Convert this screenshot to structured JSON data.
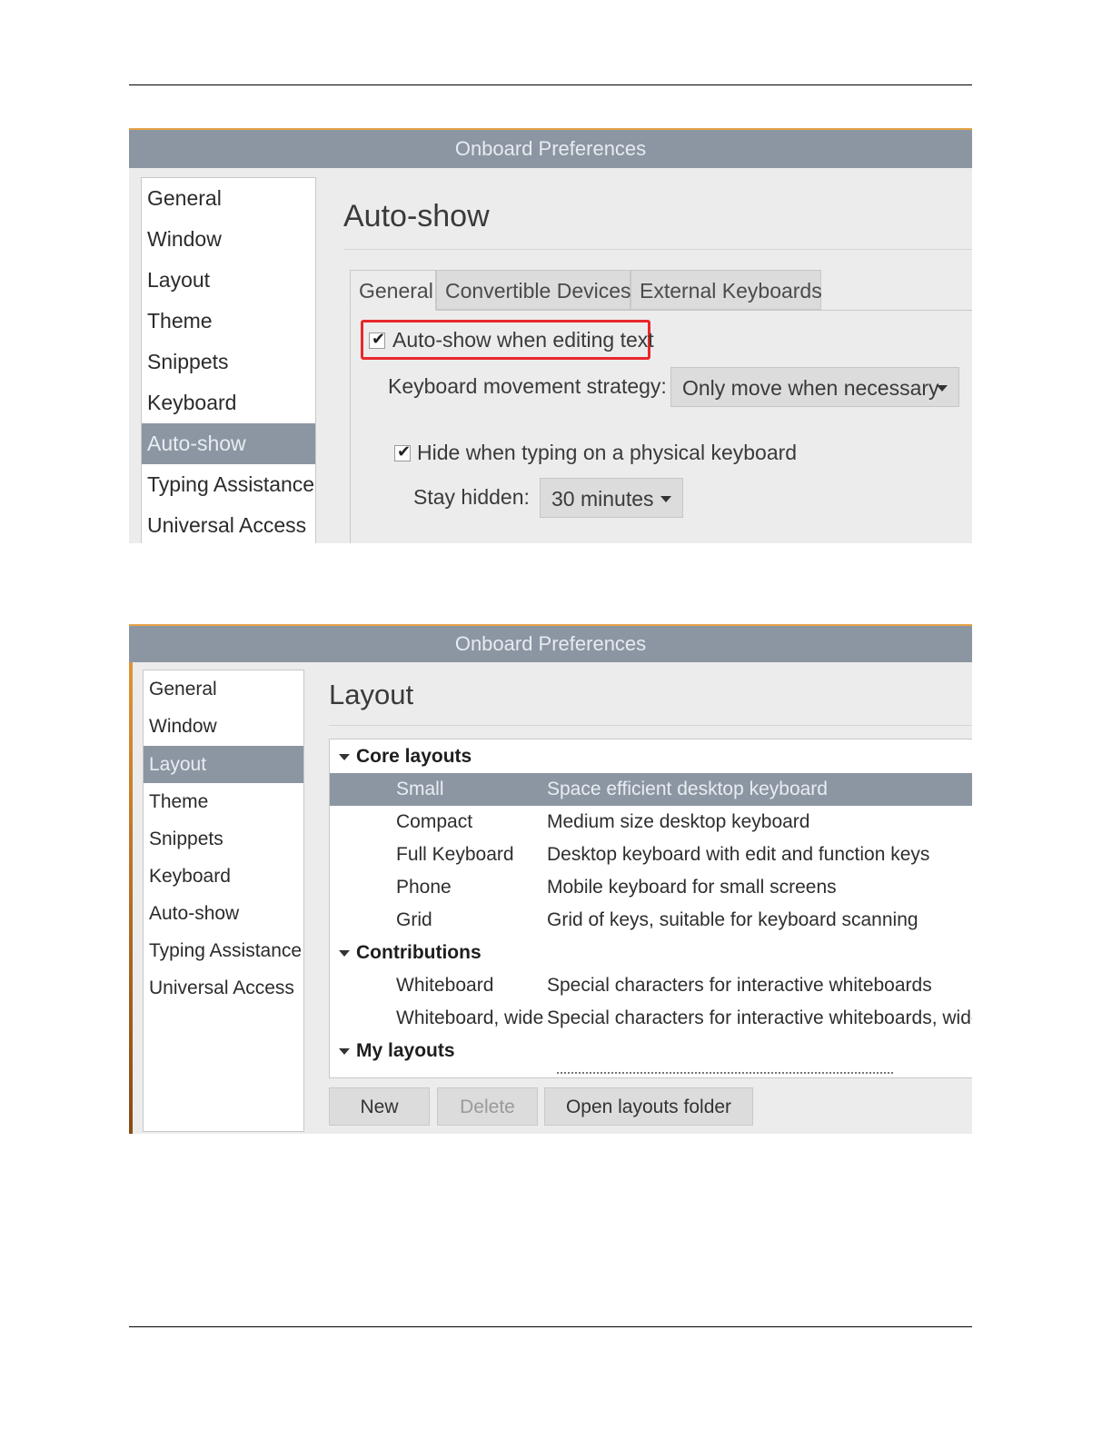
{
  "screenshot1": {
    "window_title": "Onboard Preferences",
    "sidebar": [
      {
        "label": "General"
      },
      {
        "label": "Window"
      },
      {
        "label": "Layout"
      },
      {
        "label": "Theme"
      },
      {
        "label": "Snippets"
      },
      {
        "label": "Keyboard"
      },
      {
        "label": "Auto-show",
        "active": true
      },
      {
        "label": "Typing Assistance"
      },
      {
        "label": "Universal Access"
      }
    ],
    "page_title": "Auto-show",
    "tabs": [
      {
        "label": "General",
        "active": true
      },
      {
        "label": "Convertible Devices"
      },
      {
        "label": "External Keyboards"
      }
    ],
    "auto_show_label": "Auto-show when editing text",
    "auto_show_checked": true,
    "movement_strategy_label": "Keyboard movement strategy:",
    "movement_strategy_value": "Only move when necessary",
    "hide_label": "Hide when typing on a physical keyboard",
    "hide_checked": true,
    "stay_hidden_label": "Stay hidden:",
    "stay_hidden_value": "30 minutes",
    "highlight_color": "#e8282c"
  },
  "screenshot2": {
    "window_title": "Onboard Preferences",
    "sidebar": [
      {
        "label": "General"
      },
      {
        "label": "Window"
      },
      {
        "label": "Layout",
        "active": true
      },
      {
        "label": "Theme"
      },
      {
        "label": "Snippets"
      },
      {
        "label": "Keyboard"
      },
      {
        "label": "Auto-show"
      },
      {
        "label": "Typing Assistance"
      },
      {
        "label": "Universal Access"
      }
    ],
    "page_title": "Layout",
    "groups": [
      {
        "label": "Core layouts",
        "items": [
          {
            "name": "Small",
            "desc": "Space efficient desktop keyboard",
            "selected": true
          },
          {
            "name": "Compact",
            "desc": "Medium size desktop keyboard"
          },
          {
            "name": "Full Keyboard",
            "desc": "Desktop keyboard with edit and function keys"
          },
          {
            "name": "Phone",
            "desc": "Mobile keyboard for small screens"
          },
          {
            "name": "Grid",
            "desc": "Grid of keys, suitable for keyboard scanning"
          }
        ]
      },
      {
        "label": "Contributions",
        "items": [
          {
            "name": "Whiteboard",
            "desc": "Special characters for interactive whiteboards"
          },
          {
            "name": "Whiteboard, wide",
            "desc": "Special characters for interactive whiteboards, wide"
          }
        ]
      },
      {
        "label": "My layouts",
        "items": []
      }
    ],
    "buttons": {
      "new": "New",
      "delete": "Delete",
      "open_folder": "Open layouts folder"
    },
    "accent_color": "#8c96a2"
  }
}
